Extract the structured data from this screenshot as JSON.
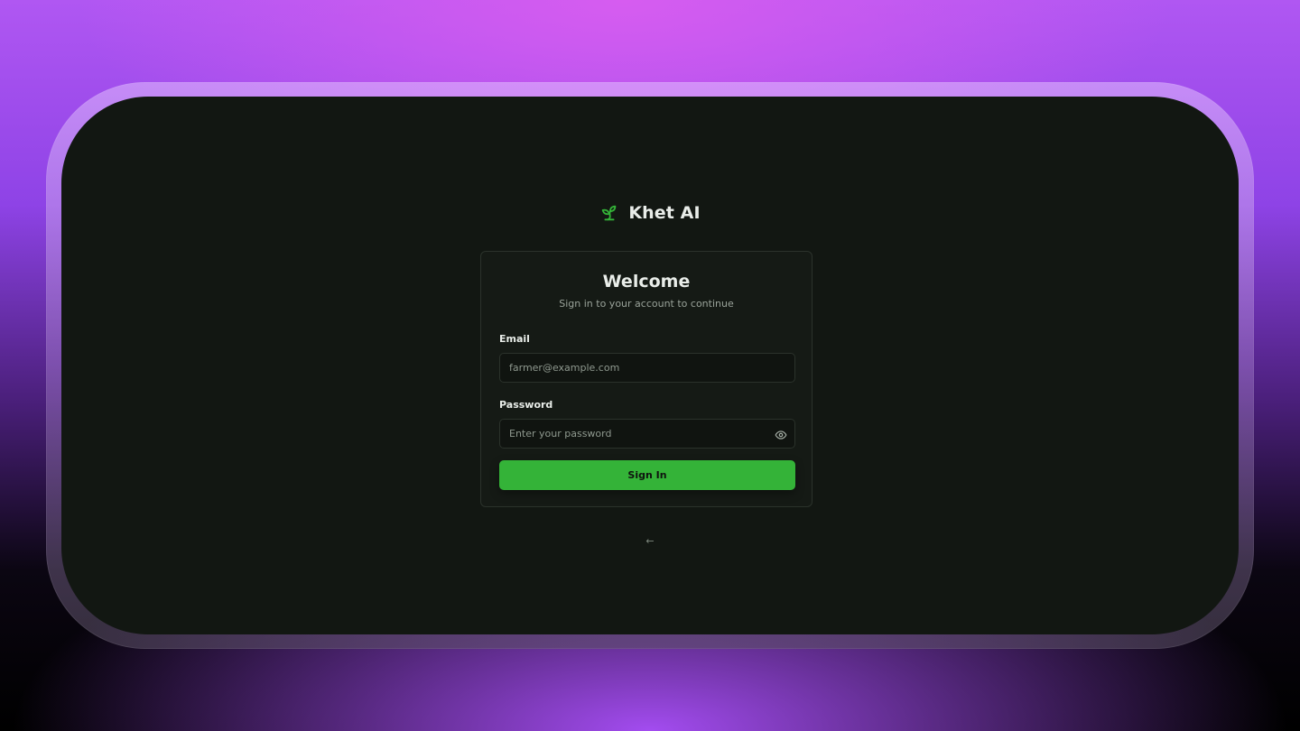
{
  "app": {
    "name": "Khet AI",
    "logo_icon": "sprout-icon",
    "accent_color": "#34b338"
  },
  "login": {
    "title": "Welcome",
    "subtitle": "Sign in to your account to continue",
    "email_label": "Email",
    "email_placeholder": "farmer@example.com",
    "password_label": "Password",
    "password_placeholder": "Enter your password",
    "toggle_visibility_icon": "eye-icon",
    "submit_label": "Sign In"
  },
  "footer": {
    "back_link": "←"
  }
}
